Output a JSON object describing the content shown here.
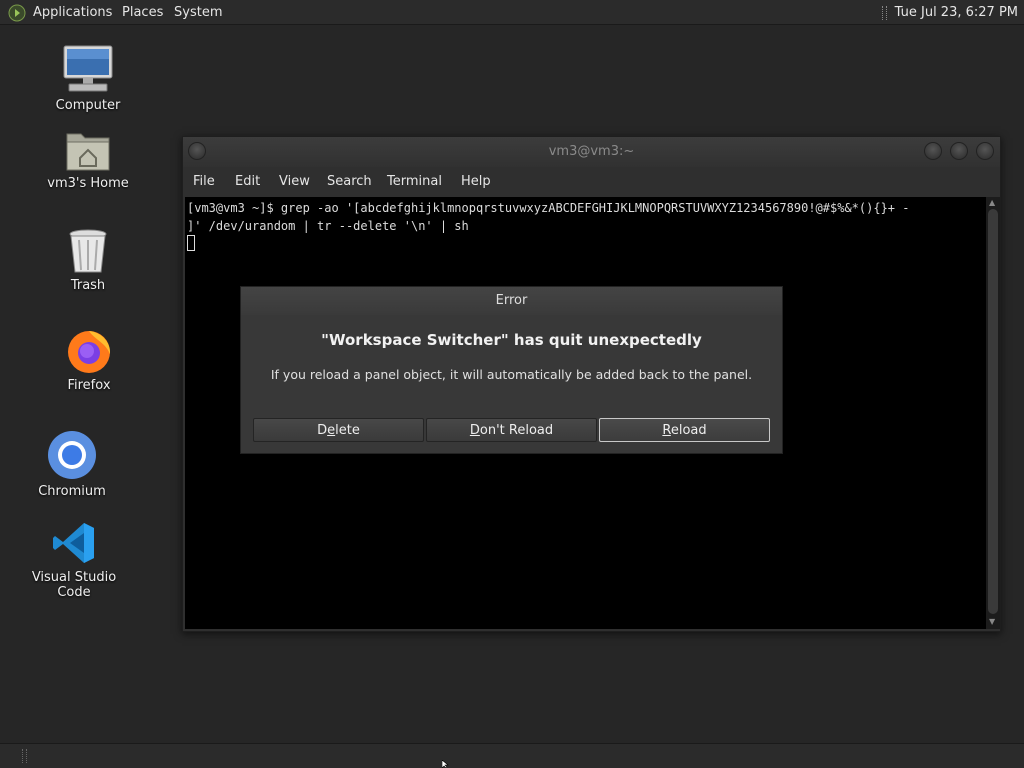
{
  "top_panel": {
    "menus": [
      "Applications",
      "Places",
      "System"
    ],
    "clock": "Tue Jul 23,  6:27 PM"
  },
  "desktop": {
    "icons": [
      {
        "label": "Computer",
        "icon": "computer-icon"
      },
      {
        "label": "vm3's Home",
        "icon": "home-folder-icon"
      },
      {
        "label": "Trash",
        "icon": "trash-icon"
      },
      {
        "label": "Firefox",
        "icon": "firefox-icon"
      },
      {
        "label": "Chromium",
        "icon": "chromium-icon"
      },
      {
        "label": "Visual Studio Code",
        "icon": "vscode-icon"
      }
    ]
  },
  "terminal": {
    "title": "vm3@vm3:~",
    "menu": [
      "File",
      "Edit",
      "View",
      "Search",
      "Terminal",
      "Help"
    ],
    "lines": [
      "[vm3@vm3 ~]$ grep -ao '[abcdefghijklmnopqrstuvwxyzABCDEFGHIJKLMNOPQRSTUVWXYZ1234567890!@#$%&*(){}+ -",
      "]' /dev/urandom | tr --delete '\\n' | sh"
    ]
  },
  "dialog": {
    "title": "Error",
    "heading": "\"Workspace Switcher\" has quit unexpectedly",
    "message": "If you reload a panel object, it will automatically be added back to the panel.",
    "buttons": {
      "delete": {
        "before": "D",
        "mnemonic": "e",
        "after": "lete"
      },
      "dont_reload": {
        "before": "",
        "mnemonic": "D",
        "after": "on't Reload"
      },
      "reload": {
        "before": "",
        "mnemonic": "R",
        "after": "eload"
      }
    }
  },
  "colors": {
    "desktop_bg": "#262626",
    "panel_bg": "#2b2b2b",
    "terminal_bg": "#000000",
    "dialog_bg": "#383838"
  }
}
